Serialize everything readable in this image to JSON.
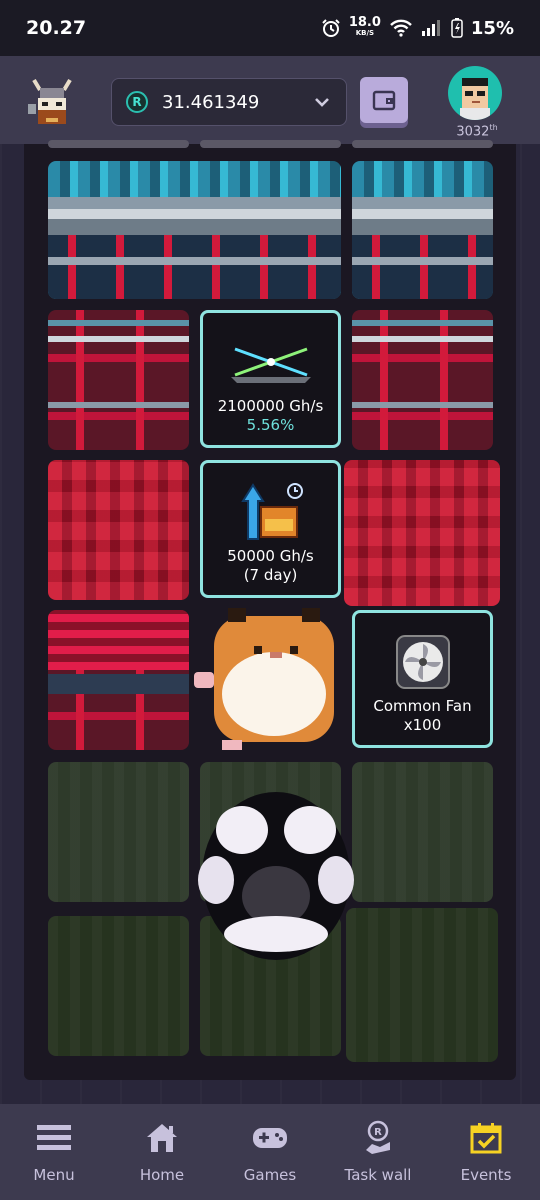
{
  "status_bar": {
    "time": "20.27",
    "net_speed": "18.0",
    "net_unit": "KB/S",
    "battery": "15%"
  },
  "header": {
    "balance": "31.461349",
    "coin_symbol": "R",
    "rank_number": "3032",
    "rank_suffix": "th"
  },
  "items": [
    {
      "name": "miner",
      "value": "2100000 Gh/s",
      "bonus": "5.56%"
    },
    {
      "name": "power-boost",
      "value": "50000 Gh/s",
      "duration": "(7 day)"
    },
    {
      "name": "fan",
      "value": "Common Fan",
      "quantity": "x100"
    }
  ],
  "nav": [
    {
      "label": "Menu",
      "icon": "menu-icon"
    },
    {
      "label": "Home",
      "icon": "home-icon"
    },
    {
      "label": "Games",
      "icon": "gamepad-icon"
    },
    {
      "label": "Task wall",
      "icon": "task-wall-icon"
    },
    {
      "label": "Events",
      "icon": "calendar-check-icon"
    }
  ],
  "colors": {
    "accent_cyan": "#8fe3e0",
    "header_bg": "#3d3a4f",
    "events_yellow": "#f6d223"
  }
}
